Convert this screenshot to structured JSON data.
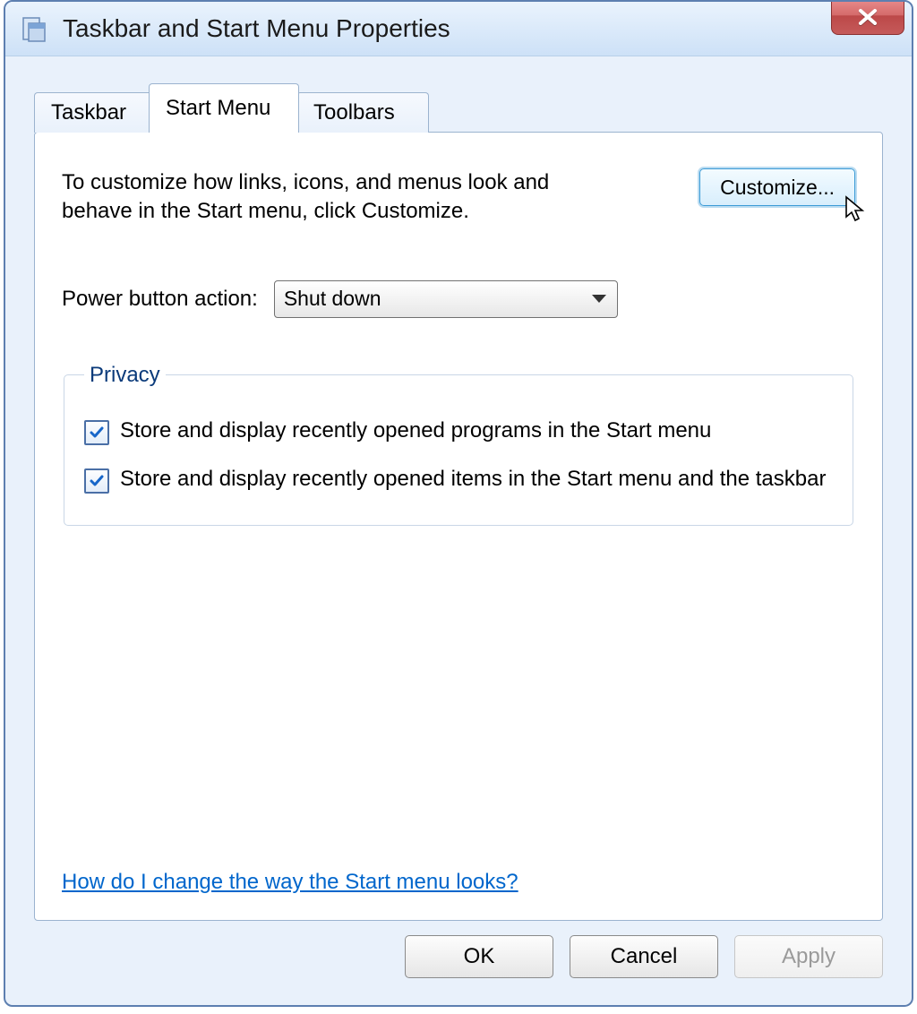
{
  "window": {
    "title": "Taskbar and Start Menu Properties"
  },
  "tabs": {
    "taskbar": "Taskbar",
    "startmenu": "Start Menu",
    "toolbars": "Toolbars",
    "active": "startmenu"
  },
  "startmenu_panel": {
    "intro": "To customize how links, icons, and menus look and behave in the Start menu, click Customize.",
    "customize_label": "Customize...",
    "power_label": "Power button action:",
    "power_selected": "Shut down",
    "privacy_legend": "Privacy",
    "privacy_recent_programs": {
      "label": "Store and display recently opened programs in the Start menu",
      "checked": true
    },
    "privacy_recent_items": {
      "label": "Store and display recently opened items in the Start menu and the taskbar",
      "checked": true
    },
    "help_link": "How do I change the way the Start menu looks?"
  },
  "buttons": {
    "ok": "OK",
    "cancel": "Cancel",
    "apply": "Apply"
  },
  "icons": {
    "app": "properties-icon",
    "close": "close-icon"
  }
}
